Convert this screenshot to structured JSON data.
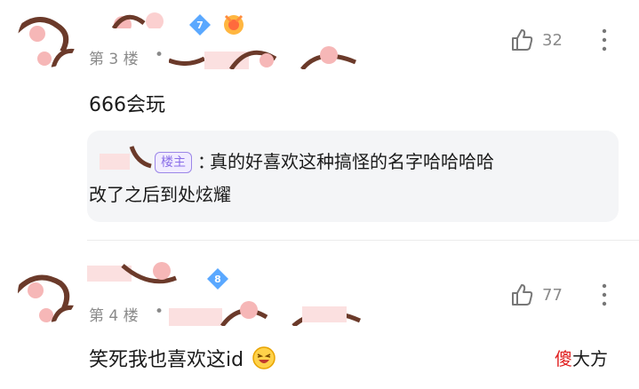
{
  "comments": [
    {
      "level": "7",
      "floor": "第 3 楼",
      "dot": "•",
      "likes": "32",
      "content": "666会玩",
      "reply": {
        "op_badge": "楼主",
        "colon": "：",
        "line1": "真的好喜欢这种搞怪的名字哈哈哈哈",
        "line2": "改了之后到处炫耀"
      }
    },
    {
      "level": "8",
      "floor": "第 4 楼",
      "dot": "•",
      "likes": "77",
      "content": "笑死我也喜欢这id"
    }
  ],
  "watermark": {
    "first": "傻",
    "rest": "大方"
  },
  "colors": {
    "level_badge": "#5aa8ff",
    "op_badge": "#8a6ee8",
    "mask_pink": "#f6b7b7",
    "mask_brown": "#6b3a2a"
  },
  "icons": [
    "thumb-up-icon",
    "more-vertical-icon",
    "level-badge-icon",
    "medal-icon",
    "laughing-emoji-icon"
  ]
}
